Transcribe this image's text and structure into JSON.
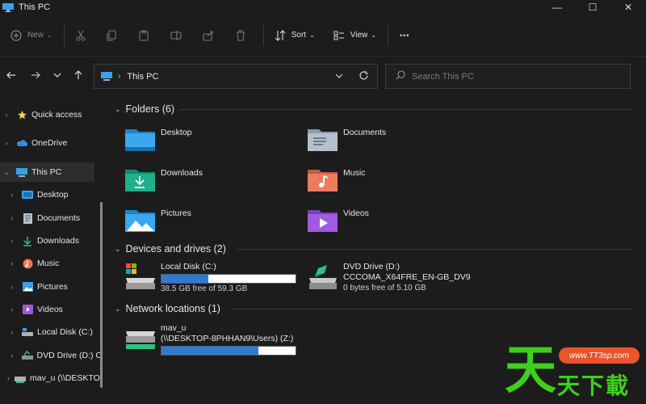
{
  "window": {
    "title": "This PC",
    "controls": {
      "minimize": "—",
      "maximize": "☐",
      "close": "✕"
    }
  },
  "toolbar": {
    "new_label": "New",
    "sort_label": "Sort",
    "view_label": "View",
    "more_label": "•••"
  },
  "address": {
    "crumb": "This PC",
    "search_placeholder": "Search This PC"
  },
  "sidebar": {
    "items": [
      {
        "label": "Quick access",
        "icon": "star-icon"
      },
      {
        "label": "OneDrive",
        "icon": "cloud-icon"
      },
      {
        "label": "This PC",
        "icon": "pc-icon"
      },
      {
        "label": "Desktop",
        "icon": "desktop-folder-icon"
      },
      {
        "label": "Documents",
        "icon": "documents-icon"
      },
      {
        "label": "Downloads",
        "icon": "downloads-icon"
      },
      {
        "label": "Music",
        "icon": "music-icon"
      },
      {
        "label": "Pictures",
        "icon": "pictures-icon"
      },
      {
        "label": "Videos",
        "icon": "videos-icon"
      },
      {
        "label": "Local Disk (C:)",
        "icon": "local-disk-icon"
      },
      {
        "label": "DVD Drive (D:) C",
        "icon": "dvd-drive-icon"
      },
      {
        "label": "mav_u (\\\\DESKTOP",
        "icon": "network-drive-icon"
      }
    ]
  },
  "main": {
    "folders_header": "Folders (6)",
    "folders": [
      {
        "label": "Desktop",
        "icon": "desktop-folder-icon"
      },
      {
        "label": "Documents",
        "icon": "documents-folder-icon"
      },
      {
        "label": "Downloads",
        "icon": "downloads-folder-icon"
      },
      {
        "label": "Music",
        "icon": "music-folder-icon"
      },
      {
        "label": "Pictures",
        "icon": "pictures-folder-icon"
      },
      {
        "label": "Videos",
        "icon": "videos-folder-icon"
      }
    ],
    "devices_header": "Devices and drives (2)",
    "drives": [
      {
        "name": "Local Disk (C:)",
        "sub": "",
        "free": "38.5 GB free of 59.3 GB",
        "used_fraction": 0.35
      },
      {
        "name": "DVD Drive (D:)",
        "sub": "CCCOMA_X64FRE_EN-GB_DV9",
        "free": "0 bytes free of 5.10 GB"
      }
    ],
    "network_header": "Network locations (1)",
    "network": [
      {
        "name": "mav_u",
        "sub": "(\\\\DESKTOP-8PHHAN9\\Users) (Z:)",
        "used_fraction": 0.72
      }
    ]
  },
  "watermark": {
    "big": "天",
    "url": "www.TT3sp.com",
    "chars": "天下載"
  },
  "colors": {
    "background": "#1c1c1c",
    "accent": "#2f7bd3",
    "selection": "#2d2d2d"
  }
}
